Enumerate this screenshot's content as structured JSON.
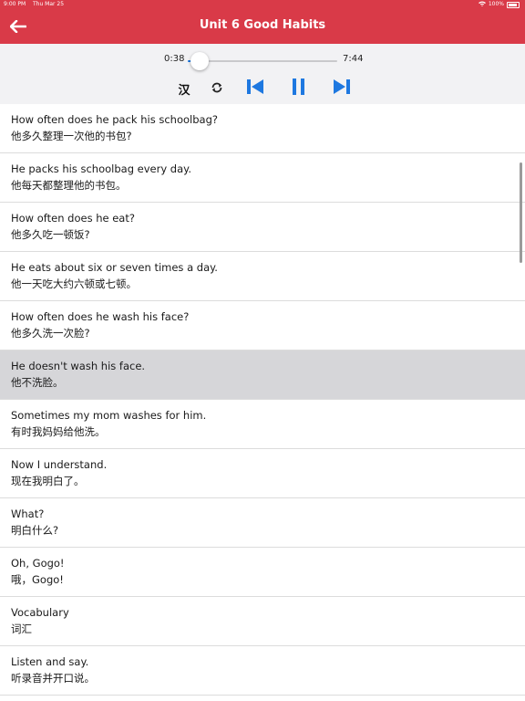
{
  "status_bar": {
    "time": "9:00 PM",
    "date": "Thu Mar 25",
    "battery": "100%"
  },
  "header": {
    "title": "Unit 6 Good Habits",
    "back_icon": "arrow-left-icon",
    "color": "#d93a48"
  },
  "player": {
    "current_time": "0:38",
    "total_time": "7:44",
    "progress": 0.08,
    "accent_color": "#1e78e0",
    "lang_toggle_label": "汉",
    "icons": [
      "repeat-icon",
      "skip-previous-icon",
      "pause-icon",
      "skip-next-icon"
    ]
  },
  "sentences": [
    {
      "en": "How often does he pack his schoolbag?",
      "cn": "他多久整理一次他的书包?",
      "selected": false
    },
    {
      "en": "He packs his schoolbag every day.",
      "cn": "他每天都整理他的书包。",
      "selected": false
    },
    {
      "en": "How often does he eat?",
      "cn": "他多久吃一顿饭?",
      "selected": false
    },
    {
      "en": "He eats about six or seven times a day.",
      "cn": "他一天吃大约六顿或七顿。",
      "selected": false
    },
    {
      "en": "How often does he wash his face?",
      "cn": "他多久洗一次脸?",
      "selected": false
    },
    {
      "en": "He doesn't wash his face.",
      "cn": "他不洗脸。",
      "selected": true
    },
    {
      "en": "Sometimes my mom washes for him.",
      "cn": "有时我妈妈给他洗。",
      "selected": false
    },
    {
      "en": "Now I understand.",
      "cn": "现在我明白了。",
      "selected": false
    },
    {
      "en": "What?",
      "cn": "明白什么?",
      "selected": false
    },
    {
      "en": "Oh, Gogo!",
      "cn": "哦，Gogo!",
      "selected": false
    },
    {
      "en": "Vocabulary",
      "cn": "词汇",
      "selected": false
    },
    {
      "en": "Listen and say.",
      "cn": "听录音并开口说。",
      "selected": false
    }
  ]
}
